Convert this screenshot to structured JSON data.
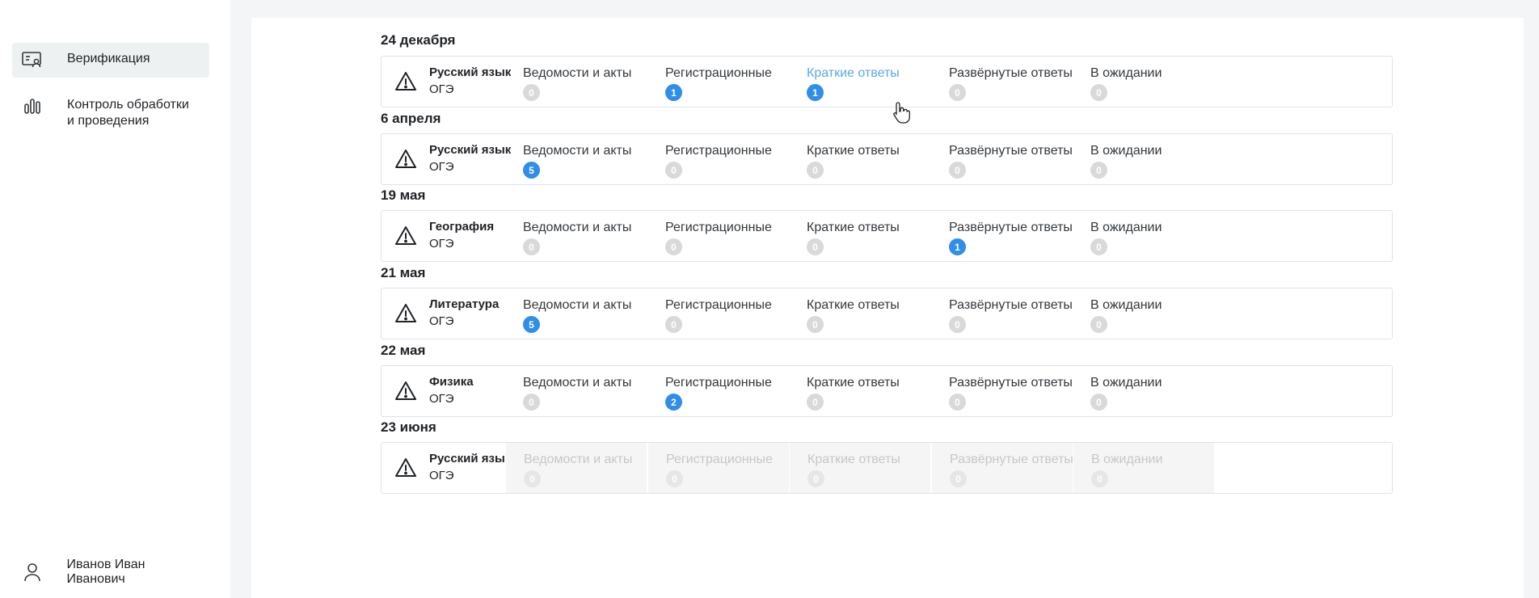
{
  "sidebar": {
    "items": [
      {
        "label": "Верификация",
        "icon": "id-card-icon",
        "active": true
      },
      {
        "label": "Контроль обработки и проведения",
        "icon": "bar-chart-icon",
        "active": false
      }
    ],
    "user": {
      "name": "Иванов Иван Иванович",
      "icon": "user-icon"
    }
  },
  "stage_labels": [
    "Ведомости и акты",
    "Регистрационные",
    "Краткие ответы",
    "Развёрнутые ответы",
    "В ожидании"
  ],
  "days": [
    {
      "date": "24 декабря",
      "subject": "Русский язык",
      "exam": "ОГЭ",
      "counts": [
        "0",
        "1",
        "1",
        "0",
        "0"
      ]
    },
    {
      "date": "6 апреля",
      "subject": "Русский язык",
      "exam": "ОГЭ",
      "counts": [
        "5",
        "0",
        "0",
        "0",
        "0"
      ]
    },
    {
      "date": "19 мая",
      "subject": "География",
      "exam": "ОГЭ",
      "counts": [
        "0",
        "0",
        "0",
        "1",
        "0"
      ]
    },
    {
      "date": "21 мая",
      "subject": "Литература",
      "exam": "ОГЭ",
      "counts": [
        "5",
        "0",
        "0",
        "0",
        "0"
      ]
    },
    {
      "date": "22 мая",
      "subject": "Физика",
      "exam": "ОГЭ",
      "counts": [
        "0",
        "2",
        "0",
        "0",
        "0"
      ]
    },
    {
      "date": "23 июня",
      "subject": "Русский язык",
      "exam": "ОГЭ",
      "counts": [
        "0",
        "0",
        "0",
        "0",
        "0"
      ],
      "disabled": true
    }
  ],
  "colors": {
    "accent": "#2f8ee8",
    "hover_link": "#5aa9e6",
    "badge_zero": "#d9d9d9"
  }
}
